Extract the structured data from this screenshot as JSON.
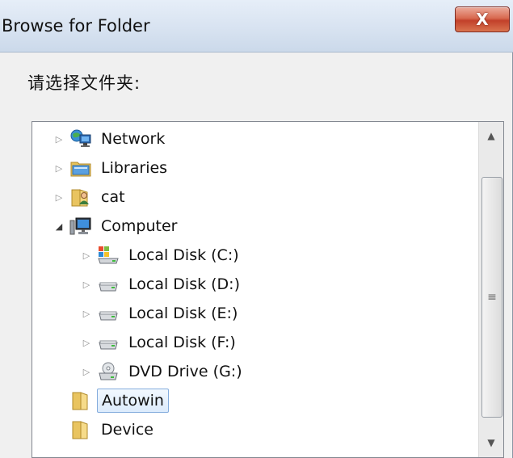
{
  "window": {
    "title": "Browse for Folder",
    "close_label": "X"
  },
  "prompt": "请选择文件夹:",
  "tree": {
    "items": [
      {
        "label": "Network",
        "expander": "collapsed",
        "icon": "network-icon"
      },
      {
        "label": "Libraries",
        "expander": "collapsed",
        "icon": "libraries-icon"
      },
      {
        "label": "cat",
        "expander": "collapsed",
        "icon": "user-folder-icon"
      },
      {
        "label": "Computer",
        "expander": "expanded",
        "icon": "computer-icon"
      },
      {
        "label": "Local Disk (C:)",
        "expander": "collapsed",
        "icon": "system-drive-icon"
      },
      {
        "label": "Local Disk (D:)",
        "expander": "collapsed",
        "icon": "drive-icon"
      },
      {
        "label": "Local Disk (E:)",
        "expander": "collapsed",
        "icon": "drive-icon"
      },
      {
        "label": "Local Disk (F:)",
        "expander": "collapsed",
        "icon": "drive-icon"
      },
      {
        "label": "DVD Drive (G:)",
        "expander": "collapsed",
        "icon": "dvd-drive-icon"
      },
      {
        "label": "Autowin",
        "expander": "none",
        "icon": "folder-icon",
        "selected": true
      },
      {
        "label": "Device",
        "expander": "none",
        "icon": "folder-icon"
      }
    ]
  },
  "scrollbar": {
    "up_arrow": "▲",
    "down_arrow": "▼",
    "grip": "≡"
  },
  "colors": {
    "selection_border": "#84acdd",
    "close_button": "#c2402a",
    "titlebar": "#d8e3f1"
  }
}
